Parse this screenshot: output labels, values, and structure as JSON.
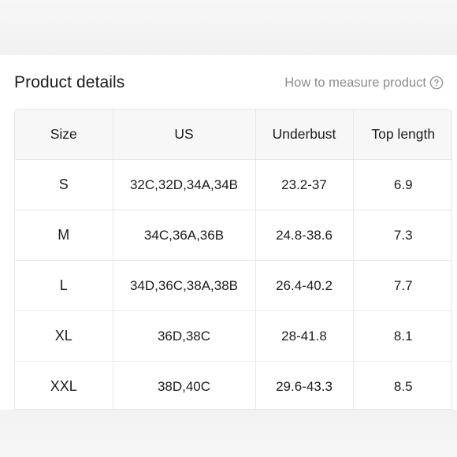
{
  "header": {
    "title": "Product details",
    "measure_link": "How to measure product"
  },
  "table": {
    "columns": [
      "Size",
      "US",
      "Underbust",
      "Top length"
    ],
    "rows": [
      {
        "size": "S",
        "us": "32C,32D,34A,34B",
        "underbust": "23.2-37",
        "top_length": "6.9"
      },
      {
        "size": "M",
        "us": "34C,36A,36B",
        "underbust": "24.8-38.6",
        "top_length": "7.3"
      },
      {
        "size": "L",
        "us": "34D,36C,38A,38B",
        "underbust": "26.4-40.2",
        "top_length": "7.7"
      },
      {
        "size": "XL",
        "us": "36D,38C",
        "underbust": "28-41.8",
        "top_length": "8.1"
      },
      {
        "size": "XXL",
        "us": "38D,40C",
        "underbust": "29.6-43.3",
        "top_length": "8.5"
      }
    ]
  },
  "icons": {
    "help": "question-circle-icon"
  },
  "colors": {
    "header_bg": "#f7f7f7",
    "border": "#e8e8e8",
    "muted_text": "#8d8d8d"
  }
}
